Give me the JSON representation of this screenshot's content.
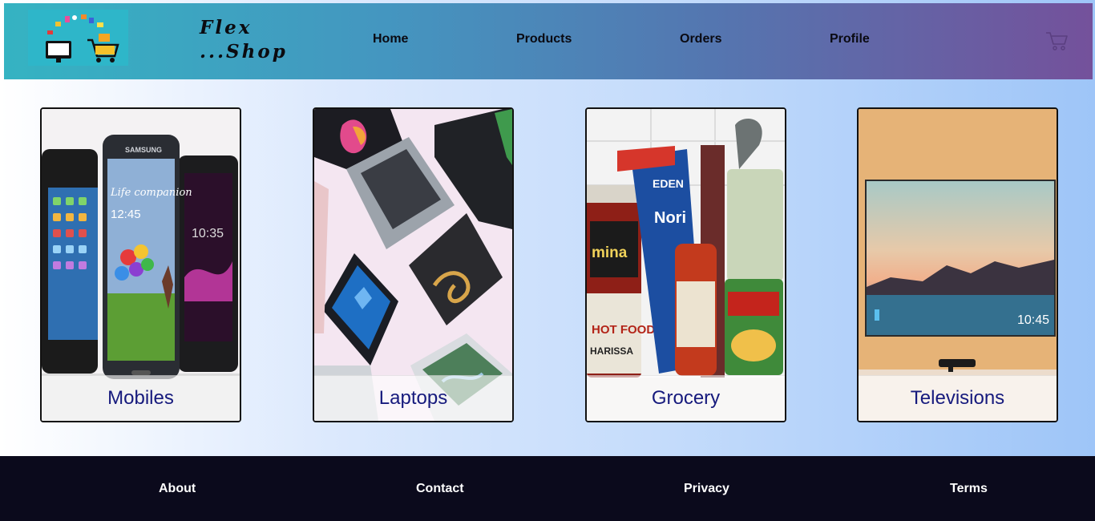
{
  "header": {
    "brand_line1": "Flex",
    "brand_line2": "...Shop",
    "nav": [
      {
        "label": "Home"
      },
      {
        "label": "Products"
      },
      {
        "label": "Orders"
      },
      {
        "label": "Profile"
      }
    ],
    "colors": {
      "gradient_start": "#35b3c2",
      "gradient_end": "#74519b"
    }
  },
  "categories": [
    {
      "label": "Mobiles",
      "image": "smartphones-image",
      "tv_time": "",
      "phone_time": "12:45",
      "phone_time2": "10:35",
      "phone_text": "Life companion",
      "phone_brand": "SAMSUNG"
    },
    {
      "label": "Laptops",
      "image": "laptops-image"
    },
    {
      "label": "Grocery",
      "image": "grocery-image",
      "pack1": "EDEN",
      "pack2": "Nori",
      "jar": "mina",
      "jar2": "HOT FOOD",
      "jar3": "HARISSA"
    },
    {
      "label": "Televisions",
      "image": "television-image",
      "tv_time": "10:45"
    }
  ],
  "footer": {
    "links": [
      {
        "label": "About"
      },
      {
        "label": "Contact"
      },
      {
        "label": "Privacy"
      },
      {
        "label": "Terms"
      }
    ],
    "background": "#0b0a1c"
  },
  "icons": {
    "cart": "cart-icon",
    "logo": "shop-logo-icon"
  }
}
